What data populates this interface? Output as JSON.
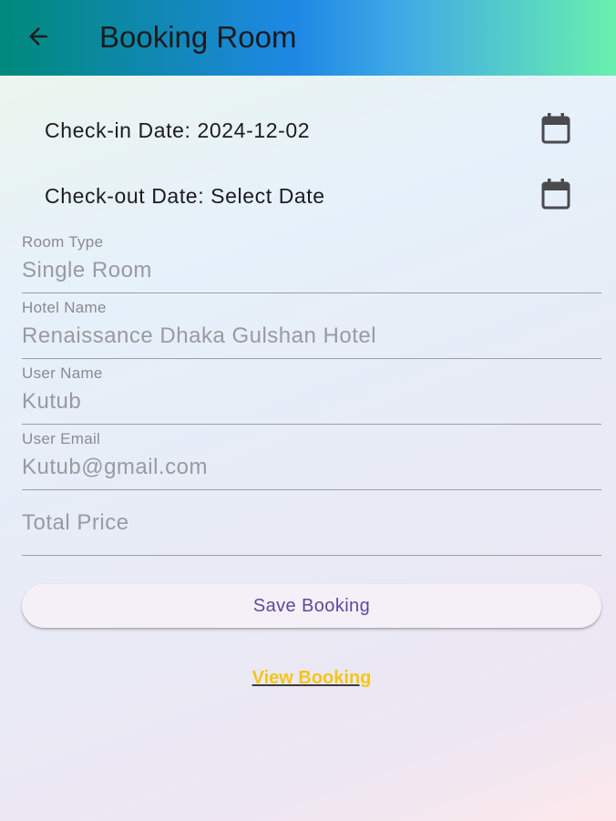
{
  "app_bar": {
    "title": "Booking Room",
    "back_icon": "arrow-back-icon"
  },
  "dates": {
    "check_in_label": "Check-in Date: 2024-12-02",
    "check_out_label": "Check-out Date: Select Date",
    "calendar_icon": "calendar-icon"
  },
  "fields": {
    "room_type": {
      "label": "Room Type",
      "value": "Single Room"
    },
    "hotel_name": {
      "label": "Hotel Name",
      "value": "Renaissance Dhaka Gulshan Hotel"
    },
    "user_name": {
      "label": "User Name",
      "value": "Kutub"
    },
    "user_email": {
      "label": "User Email",
      "value": "Kutub@gmail.com"
    },
    "total_price": {
      "placeholder": "Total Price"
    }
  },
  "actions": {
    "save_label": "Save Booking",
    "view_label": "View Booking"
  },
  "colors": {
    "accent": "#5c4a9a",
    "link": "#f5c518",
    "app_bar_start": "#00897b",
    "app_bar_mid": "#1e88e5",
    "app_bar_end": "#69f0ae"
  }
}
